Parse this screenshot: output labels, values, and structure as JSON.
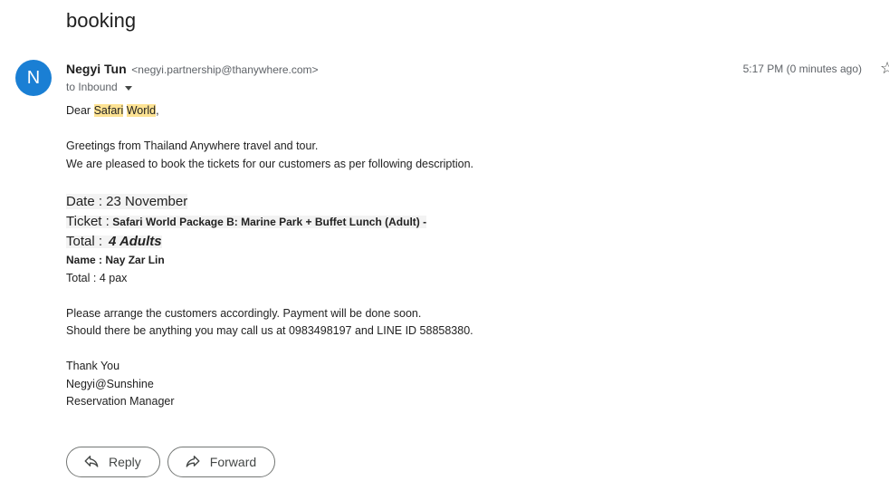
{
  "email": {
    "subject": "booking",
    "sender": {
      "avatar_letter": "N",
      "name": "Negyi Tun",
      "email": "<negyi.partnership@thanywhere.com>"
    },
    "to_label": "to Inbound",
    "timestamp": "5:17 PM (0 minutes ago)",
    "body": {
      "greeting_prefix": "Dear",
      "greeting_highlight_1": "Safari",
      "greeting_highlight_2": "World",
      "greeting_suffix": ",",
      "line_greetings": "Greetings from Thailand Anywhere travel and tour.",
      "line_pleased": "We are pleased to book the tickets for our customers as per following description.",
      "date_label": "Date : 23 November",
      "ticket_label": "Ticket :",
      "ticket_value": "Safari World Package B: Marine Park + Buffet Lunch (Adult) -",
      "total_label": "Total :",
      "total_value": "4 Adults",
      "name_line": "Name : Nay Zar Lin",
      "total_pax": "Total : 4 pax",
      "arrange": "Please arrange the customers accordingly. Payment will be done soon.",
      "contact": "Should there be anything you may call us at 0983498197 and LINE ID 58858380.",
      "thanks": "Thank You",
      "signature_name": "Negyi@Sunshine",
      "signature_title": "Reservation Manager"
    },
    "actions": {
      "reply_label": "Reply",
      "forward_label": "Forward"
    }
  },
  "colors": {
    "avatar": "#1a7fd4",
    "highlight": "#fde293"
  }
}
